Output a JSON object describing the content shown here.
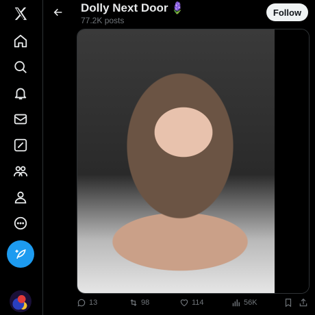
{
  "profile": {
    "name": "Dolly Next Door",
    "name_emoji": "🪻",
    "posts": "77.2K posts",
    "follow_label": "Follow"
  },
  "post": {
    "replies": "13",
    "reposts": "98",
    "likes": "114",
    "views": "56K"
  },
  "nav": {
    "icons": [
      "x-logo-icon",
      "home-icon",
      "search-icon",
      "bell-icon",
      "mail-icon",
      "grok-icon",
      "communities-icon",
      "profile-icon",
      "more-icon",
      "compose-icon"
    ]
  },
  "colors": {
    "background": "#000000",
    "accent": "#1d9bf0",
    "secondary_text": "#71767b",
    "follow_bg": "#eff3f4"
  }
}
